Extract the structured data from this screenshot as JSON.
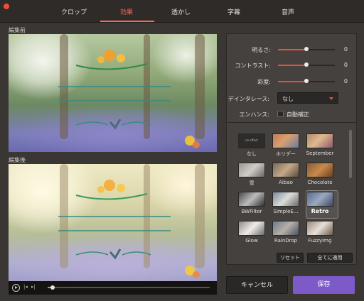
{
  "tabs": [
    {
      "label": "クロップ",
      "active": false
    },
    {
      "label": "効果",
      "active": true
    },
    {
      "label": "透かし",
      "active": false
    },
    {
      "label": "字幕",
      "active": false
    },
    {
      "label": "音声",
      "active": false
    }
  ],
  "colors": {
    "accent": "#ff6a55",
    "save": "#7c5ac8",
    "close": "#e8503e"
  },
  "preview": {
    "before_label": "編集前",
    "after_label": "編集後",
    "progress": 0.03
  },
  "adjust": {
    "brightness": {
      "label": "明るさ:",
      "value": "0",
      "level": 0.5
    },
    "contrast": {
      "label": "コントラスト:",
      "value": "0",
      "level": 0.5
    },
    "saturation": {
      "label": "彩度:",
      "value": "0",
      "level": 0.5
    }
  },
  "deinterlace": {
    "label": "デインタレース:",
    "value": "なし"
  },
  "enhance": {
    "label": "エンハンス:",
    "option": "自動補正",
    "checked": false
  },
  "filters": [
    {
      "label": "なし",
      "thumb_text": "no effect"
    },
    {
      "label": "ホリデー"
    },
    {
      "label": "September"
    },
    {
      "label": "雪"
    },
    {
      "label": "Aibao"
    },
    {
      "label": "Chocolate"
    },
    {
      "label": "BWFilter"
    },
    {
      "label": "SimpleE..."
    },
    {
      "label": "Retro",
      "selected": true
    },
    {
      "label": "Glow"
    },
    {
      "label": "RainDrop"
    },
    {
      "label": "FuzzyImg"
    }
  ],
  "buttons": {
    "reset": "リセット",
    "apply_all": "全てに適用",
    "cancel": "キャンセル",
    "save": "保存"
  }
}
